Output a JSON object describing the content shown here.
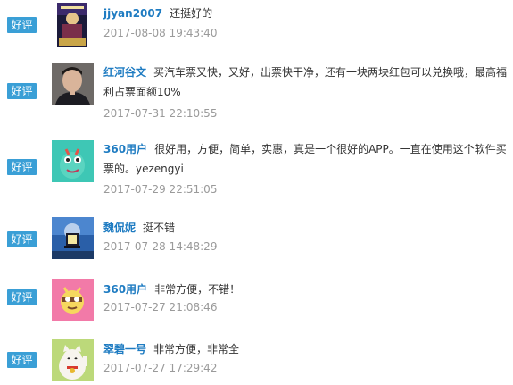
{
  "reviews": [
    {
      "badge": "好评",
      "user": "jjyan2007",
      "comment": "还挺好的",
      "date": "2017-08-08 19:43:40",
      "avatar": "movie-poster-avatar"
    },
    {
      "badge": "好评",
      "user": "红河谷文",
      "comment": "买汽车票又快，又好，出票快干净，还有一块两块红包可以兑换哦，最高福利占票面额10%",
      "date": "2017-07-31 22:10:55",
      "avatar": "man-portrait-avatar"
    },
    {
      "badge": "好评",
      "user": "360用户",
      "comment": "很好用，方便，简单，实惠，真是一个很好的APP。一直在使用这个软件买票的。yezengyi",
      "date": "2017-07-29 22:51:05",
      "avatar": "green-monster-avatar"
    },
    {
      "badge": "好评",
      "user": "魏侃妮",
      "comment": "挺不错",
      "date": "2017-07-28 14:48:29",
      "avatar": "lighthouse-avatar"
    },
    {
      "badge": "好评",
      "user": "360用户",
      "comment": "非常方便，不错！",
      "date": "2017-07-27 21:08:46",
      "avatar": "pink-cartoon-avatar"
    },
    {
      "badge": "好评",
      "user": "翠碧一号",
      "comment": "非常方便，非常全",
      "date": "2017-07-27 17:29:42",
      "avatar": "lucky-cat-avatar"
    }
  ],
  "colors": {
    "badge": "#3a9fd6",
    "username": "#1f7cc2",
    "date": "#9a9a9a",
    "text": "#333333"
  }
}
